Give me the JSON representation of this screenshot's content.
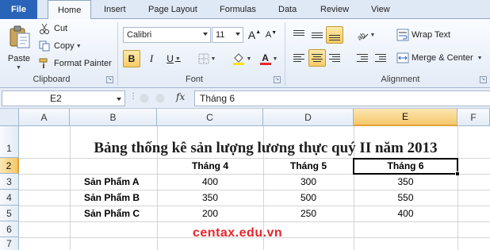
{
  "ribbon": {
    "tabs": [
      {
        "label": "File"
      },
      {
        "label": "Home"
      },
      {
        "label": "Insert"
      },
      {
        "label": "Page Layout"
      },
      {
        "label": "Formulas"
      },
      {
        "label": "Data"
      },
      {
        "label": "Review"
      },
      {
        "label": "View"
      }
    ],
    "active_tab": "Home",
    "clipboard": {
      "paste_label": "Paste",
      "cut_label": "Cut",
      "copy_label": "Copy",
      "format_painter_label": "Format Painter",
      "group_label": "Clipboard"
    },
    "font": {
      "font_name": "Calibri",
      "font_size": "11",
      "bold_label": "B",
      "italic_label": "I",
      "underline_label": "U",
      "grow_label": "A",
      "shrink_label": "A",
      "color_label": "A",
      "group_label": "Font",
      "font_color_hex": "#e8262a",
      "highlight_color_hex": "#f5e500"
    },
    "alignment": {
      "wrap_text_label": "Wrap Text",
      "merge_label": "Merge & Center",
      "group_label": "Alignment"
    }
  },
  "formula_bar": {
    "name_box": "E2",
    "fx_label": "fx",
    "content": "Tháng 6"
  },
  "sheet": {
    "columns": [
      "A",
      "B",
      "C",
      "D",
      "E",
      "F"
    ],
    "rows": [
      "1",
      "2",
      "3",
      "4",
      "5",
      "6",
      "7"
    ],
    "selected_column": "E",
    "selected_row": "2",
    "title": "Bảng thống kê sản lượng lương thực quý II năm 2013",
    "headers": [
      "Tháng 4",
      "Tháng 5",
      "Tháng 6"
    ],
    "products": [
      {
        "name": "Sản Phẩm A",
        "values": [
          "400",
          "300",
          "350"
        ]
      },
      {
        "name": "Sản Phẩm B",
        "values": [
          "350",
          "500",
          "550"
        ]
      },
      {
        "name": "Sản Phẩm C",
        "values": [
          "200",
          "250",
          "400"
        ]
      }
    ]
  },
  "watermark": "centax.edu.vn"
}
